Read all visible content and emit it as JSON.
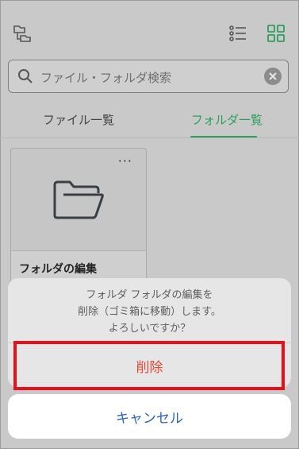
{
  "search": {
    "placeholder": "ファイル・フォルダ検索"
  },
  "tabs": [
    {
      "label": "ファイル一覧",
      "active": false
    },
    {
      "label": "フォルダ一覧",
      "active": true
    }
  ],
  "folder_card": {
    "name": "フォルダの編集"
  },
  "dialog": {
    "message_lines": [
      "フォルダ フォルダの編集を",
      "削除（ゴミ箱に移動）します。",
      "よろしいですか？"
    ],
    "delete_label": "削除",
    "cancel_label": "キャンセル"
  },
  "colors": {
    "accent": "#2f9e5e",
    "destructive": "#e04b3c",
    "cancel_text": "#2b63b8",
    "highlight_box": "#e8101a"
  },
  "icons": [
    "folder-tree-icon",
    "list-view-icon",
    "grid-view-icon",
    "search-icon",
    "clear-icon",
    "more-icon",
    "folder-icon"
  ]
}
